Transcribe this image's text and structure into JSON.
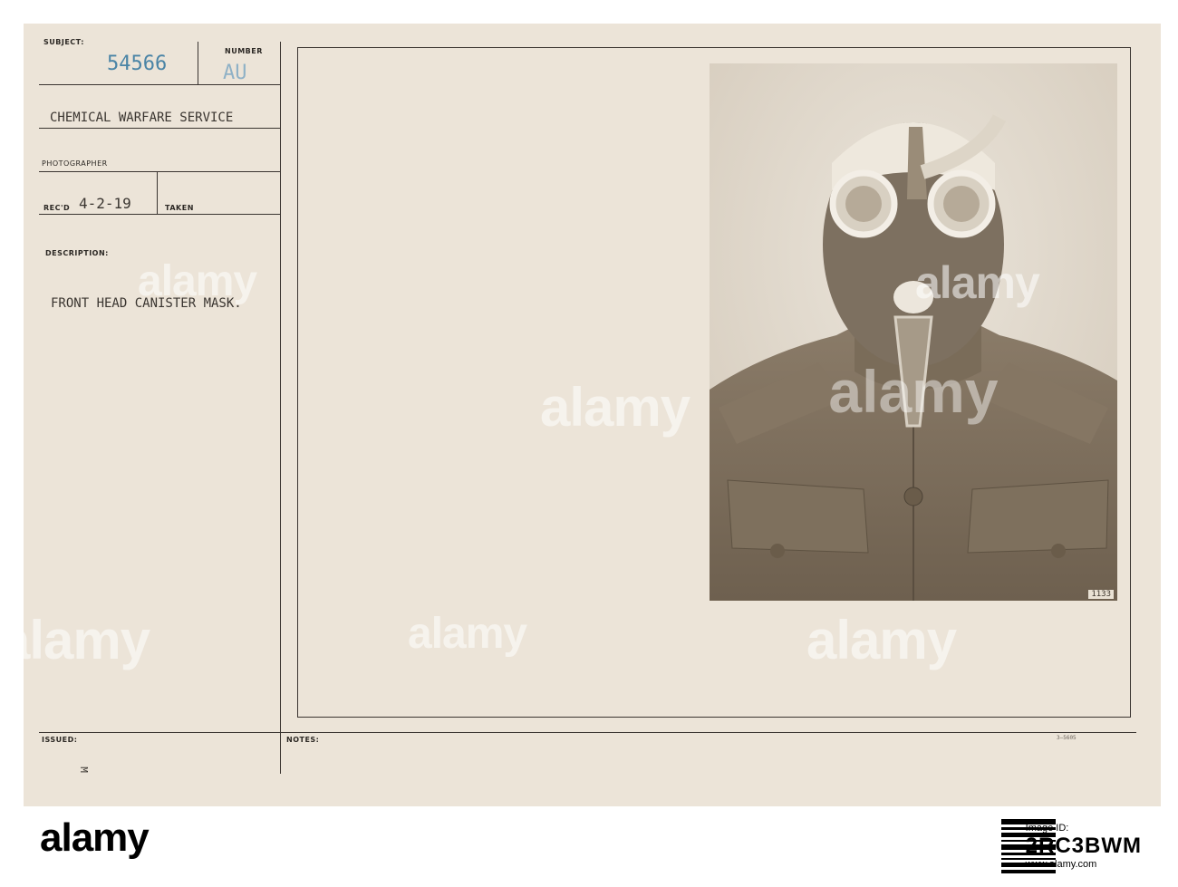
{
  "card": {
    "subject_label": "SUBJECT:",
    "subject_number": "54566",
    "number_label": "NUMBER",
    "number_stamp": "AU",
    "unit": "CHEMICAL WARFARE SERVICE",
    "photographer_label": "PHOTOGRAPHER",
    "recd_label": "REC'D",
    "recd_date": "4-2-19",
    "taken_label": "TAKEN",
    "description_label": "DESCRIPTION:",
    "description": "FRONT HEAD CANISTER MASK.",
    "issued_label": "ISSUED:",
    "issued_mark": "M",
    "notes_label": "NOTES:",
    "form_code": "3—5605",
    "photo_number": "1133"
  },
  "watermark": {
    "text": "alamy",
    "small_text": "a"
  },
  "footer": {
    "logo": "alamy",
    "image_id_label": "Image ID:",
    "image_id": "2RC3BWM",
    "site": "www.alamy.com"
  },
  "colors": {
    "card": "#ece4d8",
    "ink": "#3a3530",
    "stamp": "#4d88a8",
    "photo_sepia": "#8e7f6c"
  }
}
